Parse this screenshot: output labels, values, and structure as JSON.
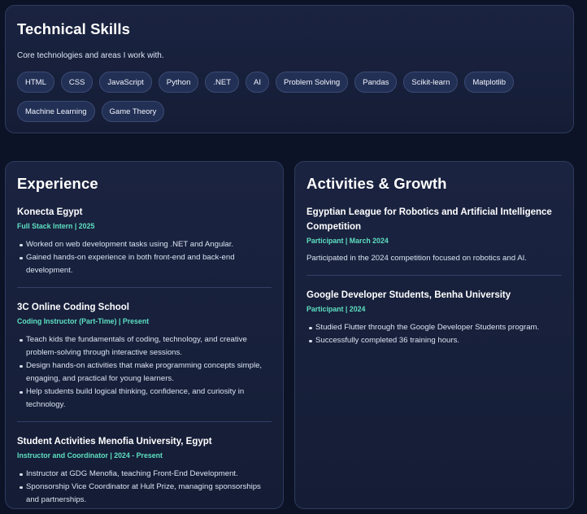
{
  "skills": {
    "title": "Technical Skills",
    "description": "Core technologies and areas I work with.",
    "chips": [
      "HTML",
      "CSS",
      "JavaScript",
      "Python",
      ".NET",
      "AI",
      "Problem Solving",
      "Pandas",
      "Scikit-learn",
      "Matplotlib",
      "Machine Learning",
      "Game Theory"
    ]
  },
  "experience": {
    "title": "Experience",
    "entries": [
      {
        "title": "Konecta Egypt",
        "meta": "Full Stack Intern | 2025",
        "bullets": [
          "Worked on web development tasks using .NET and Angular.",
          "Gained hands-on experience in both front-end and back-end development."
        ]
      },
      {
        "title": "3C Online Coding School",
        "meta": "Coding Instructor (Part-Time) | Present",
        "bullets": [
          "Teach kids the fundamentals of coding, technology, and creative problem-solving through interactive sessions.",
          "Design hands-on activities that make programming concepts simple, engaging, and practical for young learners.",
          "Help students build logical thinking, confidence, and curiosity in technology."
        ]
      },
      {
        "title": "Student Activities Menofia University, Egypt",
        "meta": "Instructor and Coordinator | 2024 - Present",
        "bullets": [
          "Instructor at GDG Menofia, teaching Front-End Development.",
          "Sponsorship Vice Coordinator at Hult Prize, managing sponsorships and partnerships."
        ]
      }
    ]
  },
  "activities": {
    "title": "Activities & Growth",
    "entries": [
      {
        "title": "Egyptian League for Robotics and Artificial Intelligence Competition",
        "meta": "Participant | March 2024",
        "description": "Participated in the 2024 competition focused on robotics and AI."
      },
      {
        "title": "Google Developer Students, Benha University",
        "meta": "Participant | 2024",
        "bullets": [
          "Studied Flutter through the Google Developer Students program.",
          "Successfully completed 36 training hours."
        ]
      }
    ]
  }
}
